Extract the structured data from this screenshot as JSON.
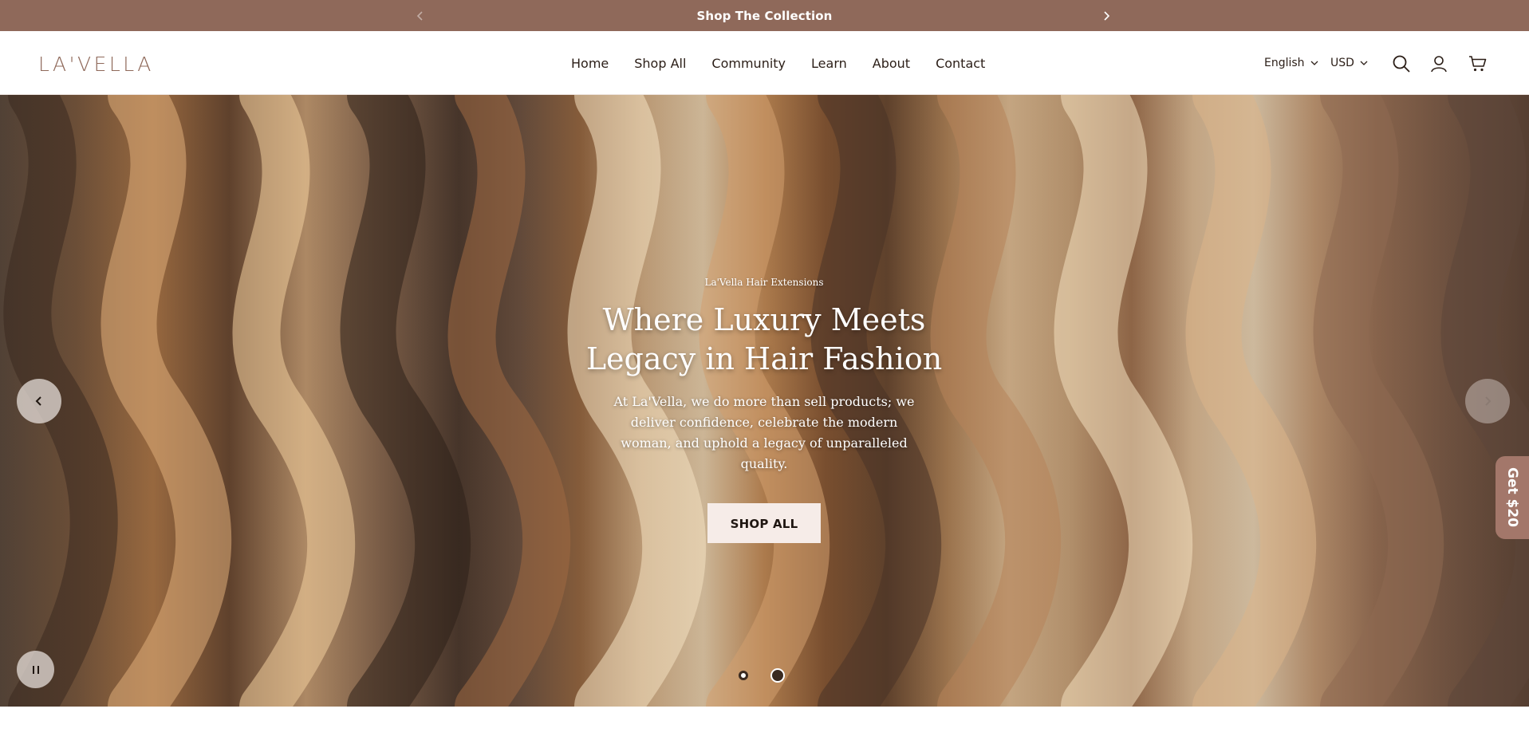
{
  "announcement": {
    "message": "Shop The Collection"
  },
  "header": {
    "logo_text": "LA'VELLA",
    "nav": [
      {
        "label": "Home"
      },
      {
        "label": "Shop All"
      },
      {
        "label": "Community"
      },
      {
        "label": "Learn"
      },
      {
        "label": "About"
      },
      {
        "label": "Contact"
      }
    ],
    "language": "English",
    "currency": "USD"
  },
  "hero": {
    "eyebrow": "La'Vella Hair Extensions",
    "headline_line1": "Where Luxury Meets",
    "headline_line2": "Legacy in Hair Fashion",
    "subtext": "At La'Vella, we do more than sell products; we deliver confidence, celebrate the modern woman, and uphold a legacy of unparalleled quality.",
    "cta_label": "SHOP ALL",
    "slide_count": 2,
    "active_slide": 2
  },
  "promo_tab": {
    "label": "Get $20"
  },
  "colors": {
    "announcement_bg": "#8f695a",
    "brand": "#8f695a",
    "cta_bg": "#f6ece8",
    "promo_bg": "#a3776a"
  },
  "icons": [
    "chevron-left-icon",
    "chevron-right-icon",
    "chevron-down-icon",
    "search-icon",
    "user-icon",
    "cart-icon",
    "pause-icon"
  ]
}
